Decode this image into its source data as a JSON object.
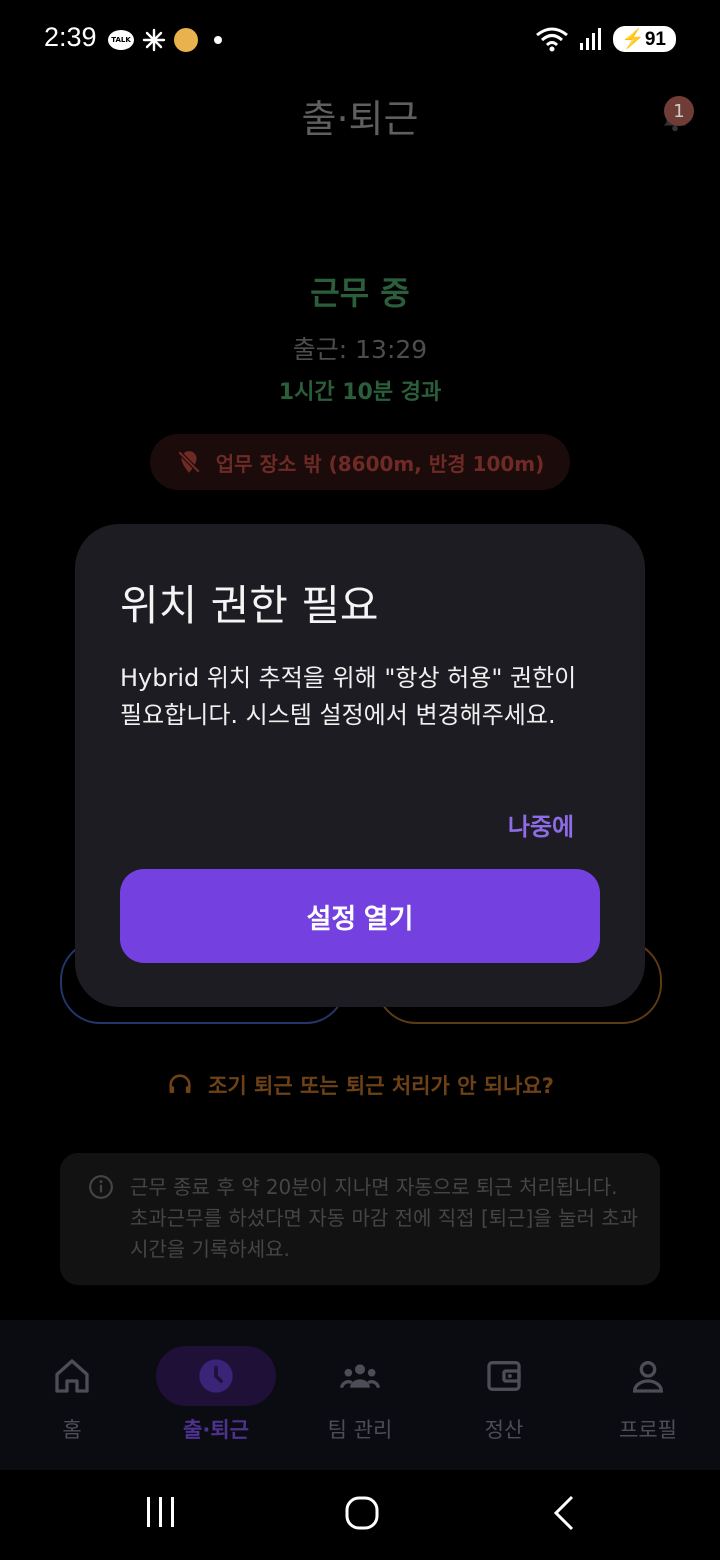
{
  "status_bar": {
    "time": "2:39",
    "talk_label": "TALK",
    "battery": "91"
  },
  "header": {
    "title": "출·퇴근",
    "notification_count": "1"
  },
  "work": {
    "status": "근무 중",
    "clock_in": "출근: 13:29",
    "elapsed": "1시간 10분 경과",
    "location_warning": "업무 장소 밖 (8600m, 반경 100m)"
  },
  "help": {
    "link": "조기 퇴근 또는 퇴근 처리가 안 되나요?"
  },
  "info": {
    "text": "근무 종료 후 약 20분이 지나면 자동으로 퇴근 처리됩니다. 초과근무를 하셨다면 자동 마감 전에 직접 [퇴근]을 눌러 초과 시간을 기록하세요."
  },
  "dialog": {
    "title": "위치 권한 필요",
    "message": "Hybrid 위치 추적을 위해 \"항상 허용\" 권한이 필요합니다. 시스템 설정에서 변경해주세요.",
    "later": "나중에",
    "open_settings": "설정 열기"
  },
  "nav": {
    "items": [
      {
        "label": "홈",
        "icon": "home-icon"
      },
      {
        "label": "출·퇴근",
        "icon": "clock-icon"
      },
      {
        "label": "팀 관리",
        "icon": "team-icon"
      },
      {
        "label": "정산",
        "icon": "wallet-icon"
      },
      {
        "label": "프로필",
        "icon": "profile-icon"
      }
    ],
    "active_index": 1
  },
  "colors": {
    "accent": "#7540e0",
    "accent_text": "#8d6ce6",
    "dialog_bg": "#1d1c22"
  }
}
